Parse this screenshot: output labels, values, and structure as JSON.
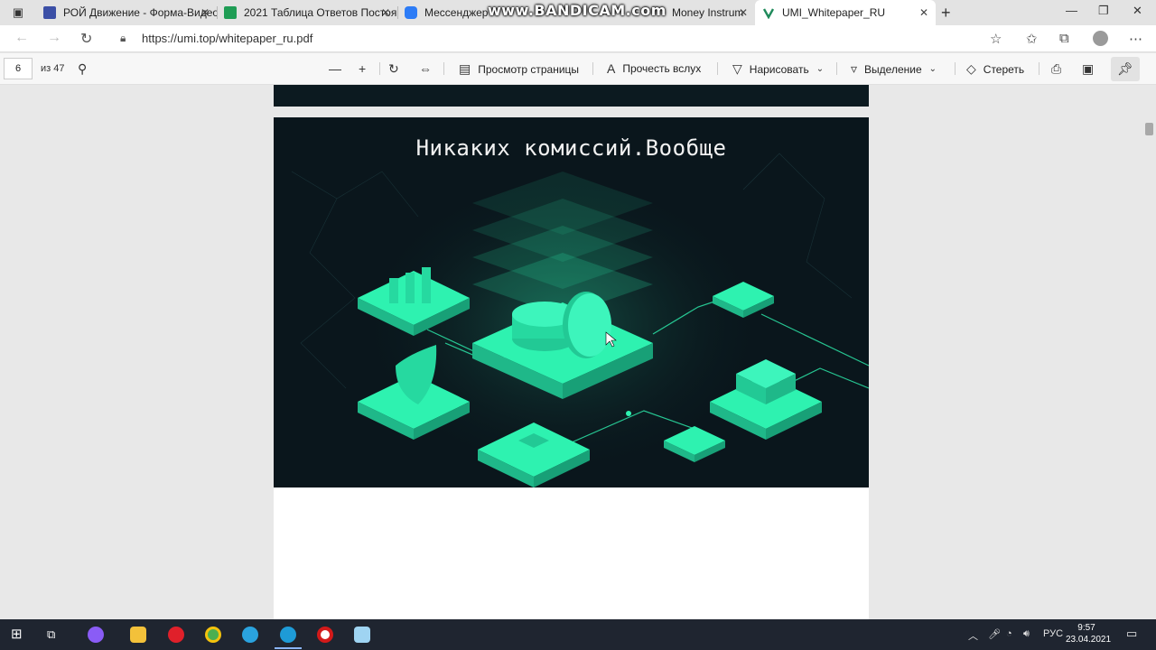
{
  "tabs": [
    {
      "label": "РОЙ Движение - Форма-Видео",
      "icon": "forms-icon",
      "color": "#3b4fa6"
    },
    {
      "label": "2021 Таблица Ответов Постоян",
      "icon": "sheets-icon",
      "color": "#1f9d55"
    },
    {
      "label": "Мессенджер",
      "icon": "messenger-icon",
      "color": "#2d7cf6"
    },
    {
      "label": "Money Instrum",
      "icon": "page-icon",
      "color": "#777777"
    },
    {
      "label": "UMI_Whitepaper_RU",
      "icon": "umi-icon",
      "color": "#1f8a5b"
    }
  ],
  "watermark": "www.BANDICAM.com",
  "address": {
    "url": "https://umi.top/whitepaper_ru.pdf"
  },
  "pdf_toolbar": {
    "page_number": "6",
    "page_count": "из 47",
    "page_view": "Просмотр страницы",
    "read_aloud": "Прочесть вслух",
    "draw": "Нарисовать",
    "highlight": "Выделение",
    "erase": "Стереть"
  },
  "document": {
    "heading": "Никаких комиссий.Вообще"
  },
  "taskbar": {
    "language": "РУС",
    "time": "9:57",
    "date": "23.04.2021"
  },
  "colors": {
    "accent_green": "#2ef2b0",
    "hero_background": "#0a161c"
  }
}
